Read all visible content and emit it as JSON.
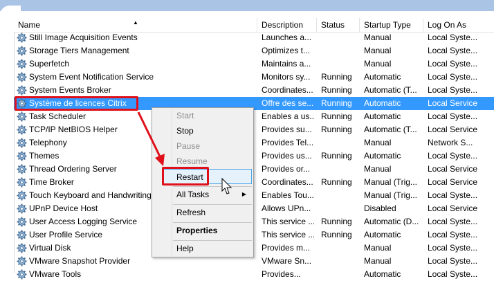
{
  "columns": {
    "name": "Name",
    "description": "Description",
    "status": "Status",
    "startup": "Startup Type",
    "logon": "Log On As"
  },
  "rows": [
    {
      "name": "Still Image Acquisition Events",
      "desc": "Launches a...",
      "status": "",
      "startup": "Manual",
      "logon": "Local Syste..."
    },
    {
      "name": "Storage Tiers Management",
      "desc": "Optimizes t...",
      "status": "",
      "startup": "Manual",
      "logon": "Local Syste..."
    },
    {
      "name": "Superfetch",
      "desc": "Maintains a...",
      "status": "",
      "startup": "Manual",
      "logon": "Local Syste..."
    },
    {
      "name": "System Event Notification Service",
      "desc": "Monitors sy...",
      "status": "Running",
      "startup": "Automatic",
      "logon": "Local Syste..."
    },
    {
      "name": "System Events Broker",
      "desc": "Coordinates...",
      "status": "Running",
      "startup": "Automatic (T...",
      "logon": "Local Syste..."
    },
    {
      "name": "Système de licences Citrix",
      "desc": "Offre des se...",
      "status": "Running",
      "startup": "Automatic",
      "logon": "Local Service"
    },
    {
      "name": "Task Scheduler",
      "desc": "Enables a us...",
      "status": "Running",
      "startup": "Automatic",
      "logon": "Local Syste..."
    },
    {
      "name": "TCP/IP NetBIOS Helper",
      "desc": "Provides su...",
      "status": "Running",
      "startup": "Automatic (T...",
      "logon": "Local Service"
    },
    {
      "name": "Telephony",
      "desc": "Provides Tel...",
      "status": "",
      "startup": "Manual",
      "logon": "Network S..."
    },
    {
      "name": "Themes",
      "desc": "Provides us...",
      "status": "Running",
      "startup": "Automatic",
      "logon": "Local Syste..."
    },
    {
      "name": "Thread Ordering Server",
      "desc": "Provides or...",
      "status": "",
      "startup": "Manual",
      "logon": "Local Service"
    },
    {
      "name": "Time Broker",
      "desc": "Coordinates...",
      "status": "Running",
      "startup": "Manual (Trig...",
      "logon": "Local Service"
    },
    {
      "name": "Touch Keyboard and Handwriting",
      "desc": "Enables Tou...",
      "status": "",
      "startup": "Manual (Trig...",
      "logon": "Local Syste..."
    },
    {
      "name": "UPnP Device Host",
      "desc": "Allows UPn...",
      "status": "",
      "startup": "Disabled",
      "logon": "Local Service"
    },
    {
      "name": "User Access Logging Service",
      "desc": "This service ...",
      "status": "Running",
      "startup": "Automatic (D...",
      "logon": "Local Syste..."
    },
    {
      "name": "User Profile Service",
      "desc": "This service ...",
      "status": "Running",
      "startup": "Automatic",
      "logon": "Local Syste..."
    },
    {
      "name": "Virtual Disk",
      "desc": "Provides m...",
      "status": "",
      "startup": "Manual",
      "logon": "Local Syste..."
    },
    {
      "name": "VMware Snapshot Provider",
      "desc": "VMware Sn...",
      "status": "",
      "startup": "Manual",
      "logon": "Local Syste..."
    },
    {
      "name": "VMware Tools",
      "desc": "Provides...",
      "status": "",
      "startup": "Automatic",
      "logon": "Local Syste..."
    }
  ],
  "selected_row_index": 5,
  "context_menu": {
    "start": "Start",
    "stop": "Stop",
    "pause": "Pause",
    "resume": "Resume",
    "restart": "Restart",
    "all_tasks": "All Tasks",
    "refresh": "Refresh",
    "properties": "Properties",
    "help": "Help"
  },
  "colors": {
    "selection": "#3399ff",
    "highlight_box": "#e0101a",
    "window_frame": "#a9c4e4"
  }
}
